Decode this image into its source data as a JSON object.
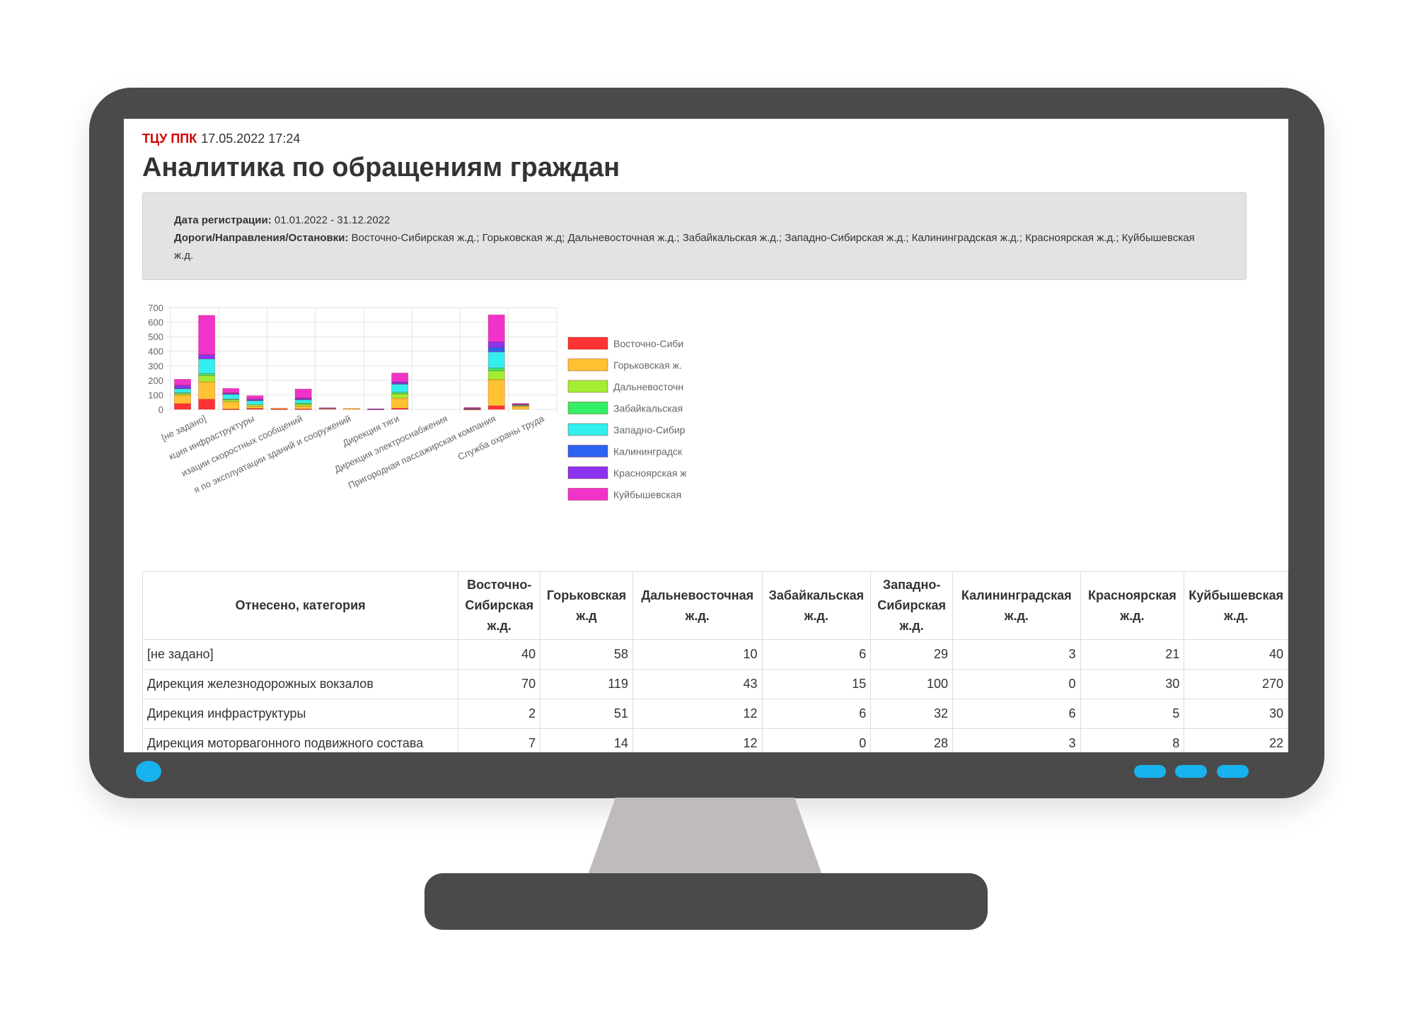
{
  "header": {
    "org": "ТЦУ ППК",
    "datetime": "17.05.2022 17:24",
    "title": "Аналитика по обращениям граждан"
  },
  "filters": {
    "date_label": "Дата регистрации:",
    "date_value": "01.01.2022 - 31.12.2022",
    "roads_label": "Дороги/Направления/Остановки:",
    "roads_value": "Восточно-Сибирская ж.д.; Горьковская ж.д; Дальневосточная ж.д.; Забайкальская ж.д.; Западно-Сибирская ж.д.; Калининградская ж.д.; Красноярская ж.д.; Куйбышевская ж.д."
  },
  "chart_data": {
    "type": "bar",
    "stacked": true,
    "ylim": [
      0,
      700
    ],
    "yticks": [
      0,
      100,
      200,
      300,
      400,
      500,
      600,
      700
    ],
    "grid": true,
    "legend_position": "right",
    "x_tick_labels": [
      "[не задано]",
      "кция инфраструктуры",
      "изации скоростных сообщений",
      "я по эксплуатации зданий и сооружений",
      "Дирекция тяги",
      "Дирекция электроснабжения",
      "Пригородная пассажирская компания",
      "Служба охраны труда"
    ],
    "series": [
      {
        "name": "Восточно-Сиби",
        "color": "#ff3333",
        "values": [
          40,
          70,
          2,
          7,
          3,
          3,
          0,
          0,
          0,
          8,
          0,
          0,
          1,
          25,
          0,
          0
        ]
      },
      {
        "name": "Горьковская ж.",
        "color": "#ffc233",
        "values": [
          58,
          119,
          51,
          14,
          6,
          20,
          5,
          7,
          0,
          70,
          0,
          0,
          1,
          180,
          20,
          0
        ]
      },
      {
        "name": "Дальневосточн",
        "color": "#a3ee33",
        "values": [
          10,
          43,
          12,
          12,
          0,
          12,
          3,
          0,
          0,
          28,
          0,
          0,
          1,
          60,
          5,
          0
        ]
      },
      {
        "name": "Забайкальская",
        "color": "#33ee66",
        "values": [
          6,
          15,
          6,
          0,
          0,
          8,
          0,
          0,
          0,
          12,
          0,
          0,
          1,
          20,
          3,
          0
        ]
      },
      {
        "name": "Западно-Сибир",
        "color": "#33eeee",
        "values": [
          29,
          100,
          32,
          28,
          0,
          25,
          2,
          0,
          2,
          55,
          0,
          0,
          2,
          110,
          5,
          0
        ]
      },
      {
        "name": "Калининградск",
        "color": "#2b64f0",
        "values": [
          3,
          0,
          6,
          3,
          0,
          2,
          0,
          0,
          1,
          5,
          0,
          0,
          2,
          30,
          2,
          0
        ]
      },
      {
        "name": "Красноярская ж",
        "color": "#8a33f0",
        "values": [
          21,
          30,
          5,
          8,
          0,
          10,
          1,
          0,
          1,
          12,
          0,
          0,
          2,
          40,
          3,
          0
        ]
      },
      {
        "name": "Куйбышевская",
        "color": "#f033c9",
        "values": [
          40,
          270,
          30,
          22,
          0,
          60,
          0,
          0,
          0,
          60,
          0,
          0,
          3,
          185,
          3,
          0
        ]
      }
    ]
  },
  "table": {
    "columns": [
      "Отнесено, категория",
      "Восточно-Сибирская ж.д.",
      "Горьковская ж.д",
      "Дальневосточная ж.д.",
      "Забайкальская ж.д.",
      "Западно-Сибирская ж.д.",
      "Калининградская ж.д.",
      "Красноярская ж.д.",
      "Куйбышевская ж.д."
    ],
    "rows": [
      {
        "category": "[не задано]",
        "values": [
          "40",
          "58",
          "10",
          "6",
          "29",
          "3",
          "21",
          "40"
        ]
      },
      {
        "category": "Дирекция железнодорожных вокзалов",
        "values": [
          "70",
          "119",
          "43",
          "15",
          "100",
          "0",
          "30",
          "270"
        ]
      },
      {
        "category": "Дирекция инфраструктуры",
        "values": [
          "2",
          "51",
          "12",
          "6",
          "32",
          "6",
          "5",
          "30"
        ]
      },
      {
        "category": "Дирекция моторвагонного подвижного состава",
        "values": [
          "7",
          "14",
          "12",
          "0",
          "28",
          "3",
          "8",
          "22"
        ]
      }
    ]
  },
  "colors": {
    "monitor": "#4a4a4a",
    "stand": "#bfbbba",
    "indicator": "#18b3ee",
    "org_red": "#d40000"
  }
}
